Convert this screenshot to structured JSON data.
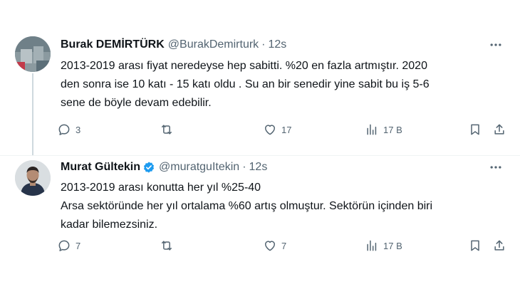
{
  "tweets": [
    {
      "name": "Burak DEMİRTÜRK",
      "handle": "@BurakDemirturk",
      "separator": "·",
      "time": "12s",
      "verified": false,
      "lines": [
        "2013-2019 arası fiyat neredeyse hep sabitti. %20  en fazla artmıştır. 2020",
        "den sonra ise 10 katı - 15 katı oldu . Su an bir senedir yine sabit bu iş 5-6",
        "sene de böyle devam edebilir."
      ],
      "replies": "3",
      "retweets": "",
      "likes": "17",
      "views": "17 B"
    },
    {
      "name": "Murat Gültekin",
      "handle": "@muratguItekin",
      "separator": "·",
      "time": "12s",
      "verified": true,
      "lines": [
        "2013-2019 arası konutta her yıl %25-40",
        "Arsa sektöründe her yıl ortalama %60 artış olmuştur. Sektörün içinden biri",
        "kadar bilemezsiniz."
      ],
      "replies": "7",
      "retweets": "",
      "likes": "7",
      "views": "17 B"
    }
  ],
  "icons": {
    "reply": "reply-icon",
    "retweet": "retweet-icon",
    "like": "heart-icon",
    "views": "views-icon",
    "bookmark": "bookmark-icon",
    "share": "share-icon",
    "more": "more-icon",
    "verified": "verified-badge-icon"
  },
  "colors": {
    "text": "#0f1419",
    "secondary": "#536471",
    "verified": "#1d9bf0",
    "thread_line": "#cfd9de"
  }
}
